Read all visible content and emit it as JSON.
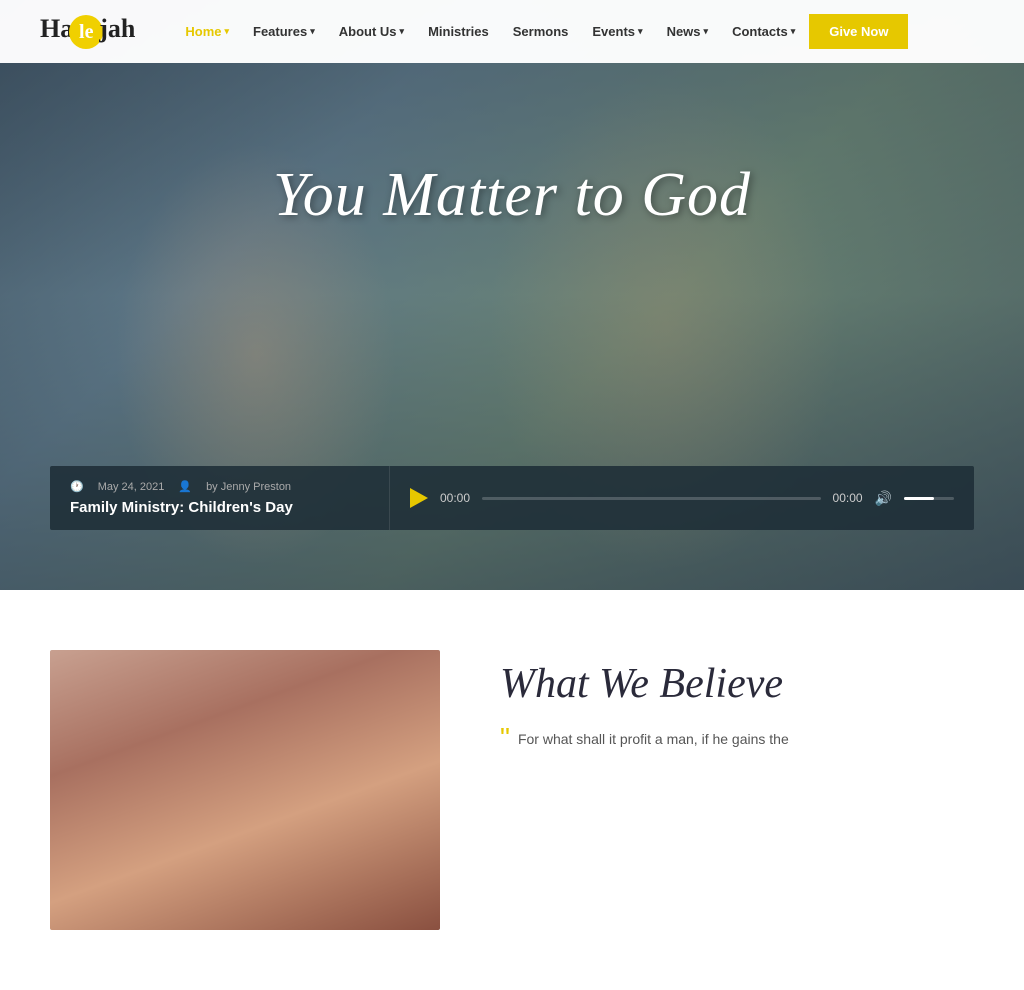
{
  "logo": {
    "text_before": "Ha",
    "circle_letter": "le",
    "text_after": "jah"
  },
  "nav": {
    "items": [
      {
        "label": "Home",
        "has_dropdown": true,
        "active": true
      },
      {
        "label": "Features",
        "has_dropdown": true,
        "active": false
      },
      {
        "label": "About Us",
        "has_dropdown": true,
        "active": false
      },
      {
        "label": "Ministries",
        "has_dropdown": false,
        "active": false
      },
      {
        "label": "Sermons",
        "has_dropdown": false,
        "active": false
      },
      {
        "label": "Events",
        "has_dropdown": true,
        "active": false
      },
      {
        "label": "News",
        "has_dropdown": true,
        "active": false
      },
      {
        "label": "Contacts",
        "has_dropdown": true,
        "active": false
      }
    ],
    "cta_label": "Give Now"
  },
  "hero": {
    "title": "You Matter to God"
  },
  "audio": {
    "date": "May 24, 2021",
    "author": "by Jenny Preston",
    "title": "Family Ministry: Children's Day",
    "time_current": "00:00",
    "time_total": "00:00",
    "progress_percent": 0,
    "volume_percent": 60
  },
  "believe": {
    "heading": "What We Believe",
    "quote": "For what shall it profit a man, if he gains the"
  }
}
